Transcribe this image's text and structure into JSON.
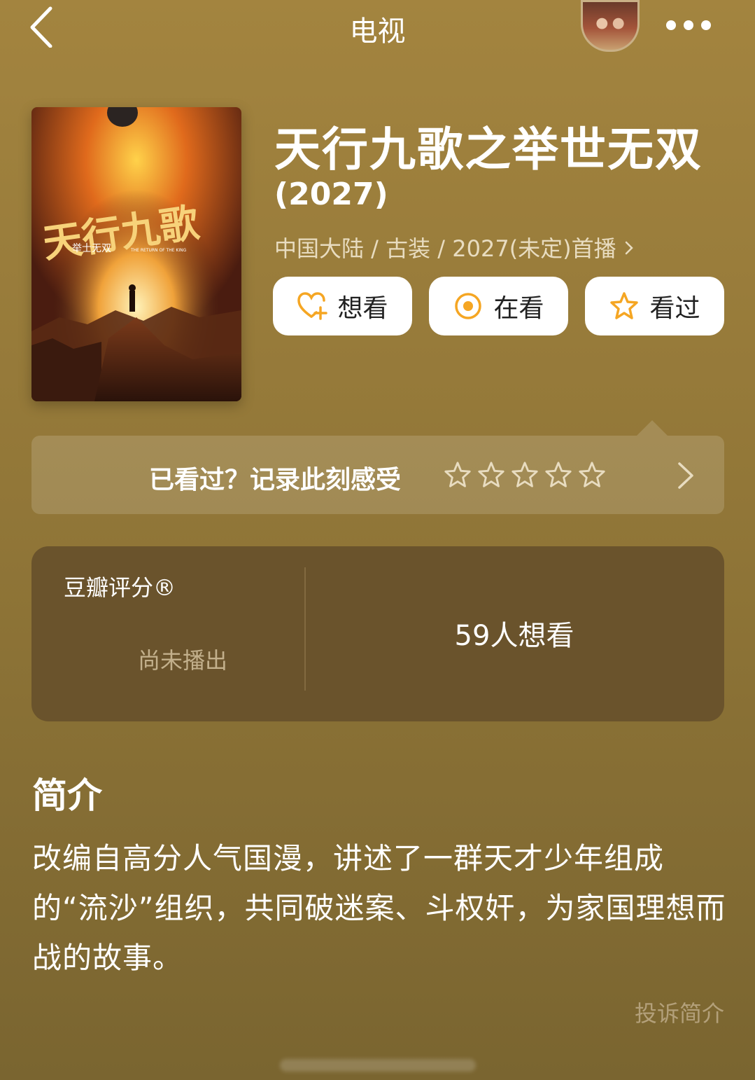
{
  "nav": {
    "title": "电视",
    "back_icon": "chevron-left-icon",
    "more_icon": "more-dots-icon"
  },
  "poster": {
    "title_art": "天行九歌",
    "subtitle_art": "举士无双",
    "english_art": "THE RETURN OF THE KING"
  },
  "subject": {
    "title": "天行九歌之举世无双",
    "year": "(2027)",
    "meta": "中国大陆 / 古装 / 2027(未定)首播"
  },
  "actions": {
    "want": "想看",
    "watching": "在看",
    "watched": "看过"
  },
  "rate": {
    "prompt": "已看过？记录此刻感受",
    "star_count": 5
  },
  "rating_card": {
    "label": "豆瓣评分®",
    "status": "尚未播出",
    "wants": "59人想看"
  },
  "synopsis": {
    "title": "简介",
    "body": "改编自高分人气国漫，讲述了一群天才少年组成的“流沙”组织，共同破迷案、斗权奸，为家国理想而战的故事。",
    "report": "投诉简介"
  },
  "colors": {
    "background": "#a3843f",
    "card": "#6a532c",
    "accent": "#f5a623"
  }
}
